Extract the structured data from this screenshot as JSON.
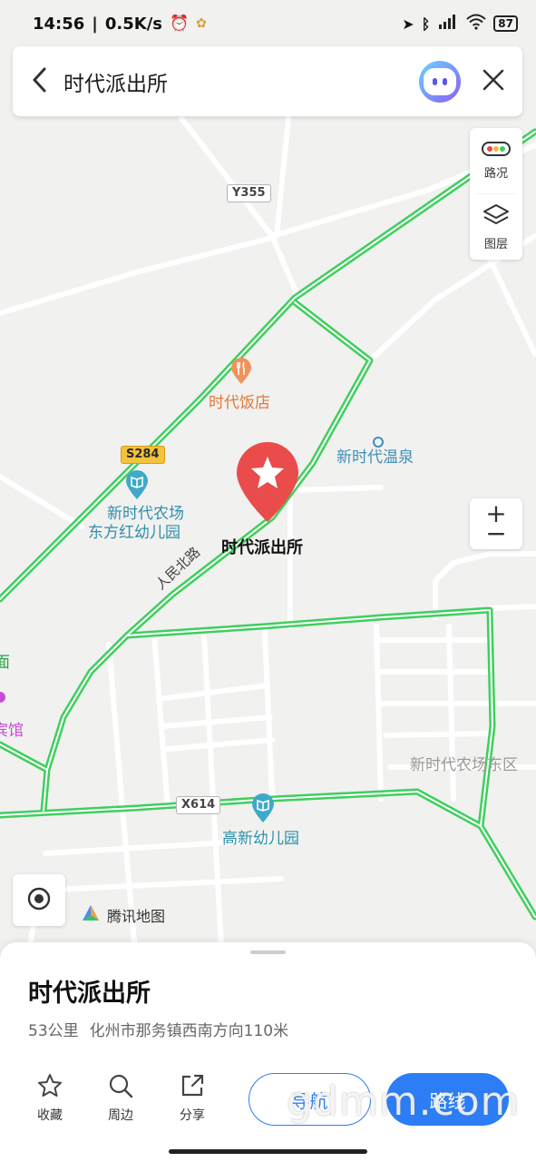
{
  "status_bar": {
    "time": "14:56",
    "speed": "0.5K/s",
    "battery": "87"
  },
  "search": {
    "title": "时代派出所"
  },
  "controls": {
    "traffic_label": "路况",
    "layers_label": "图层",
    "zoom_in": "+",
    "zoom_out": "−"
  },
  "map": {
    "labels": {
      "y355": "Y355",
      "s284": "S284",
      "x614": "X614",
      "restaurant": "时代饭店",
      "hot_spring": "新时代温泉",
      "kindergarten1_line1": "新时代农场",
      "kindergarten1_line2": "东方红幼儿园",
      "police_station": "时代派出所",
      "road_name": "人民北路",
      "east_area": "新时代农场东区",
      "kindergarten2": "高新幼儿园",
      "edge_text1": "面",
      "edge_text2": "宾馆"
    },
    "brand": "腾讯地图"
  },
  "place": {
    "name": "时代派出所",
    "distance": "53公里",
    "address": "化州市那务镇西南方向110米"
  },
  "actions": {
    "favorite": "收藏",
    "nearby": "周边",
    "share": "分享",
    "navigate": "导航",
    "route": "路线"
  },
  "watermark": "gdmm.com",
  "colors": {
    "accent": "#2c7df6",
    "road_green": "#3fcf5f",
    "marker": "#ea4b4b"
  }
}
